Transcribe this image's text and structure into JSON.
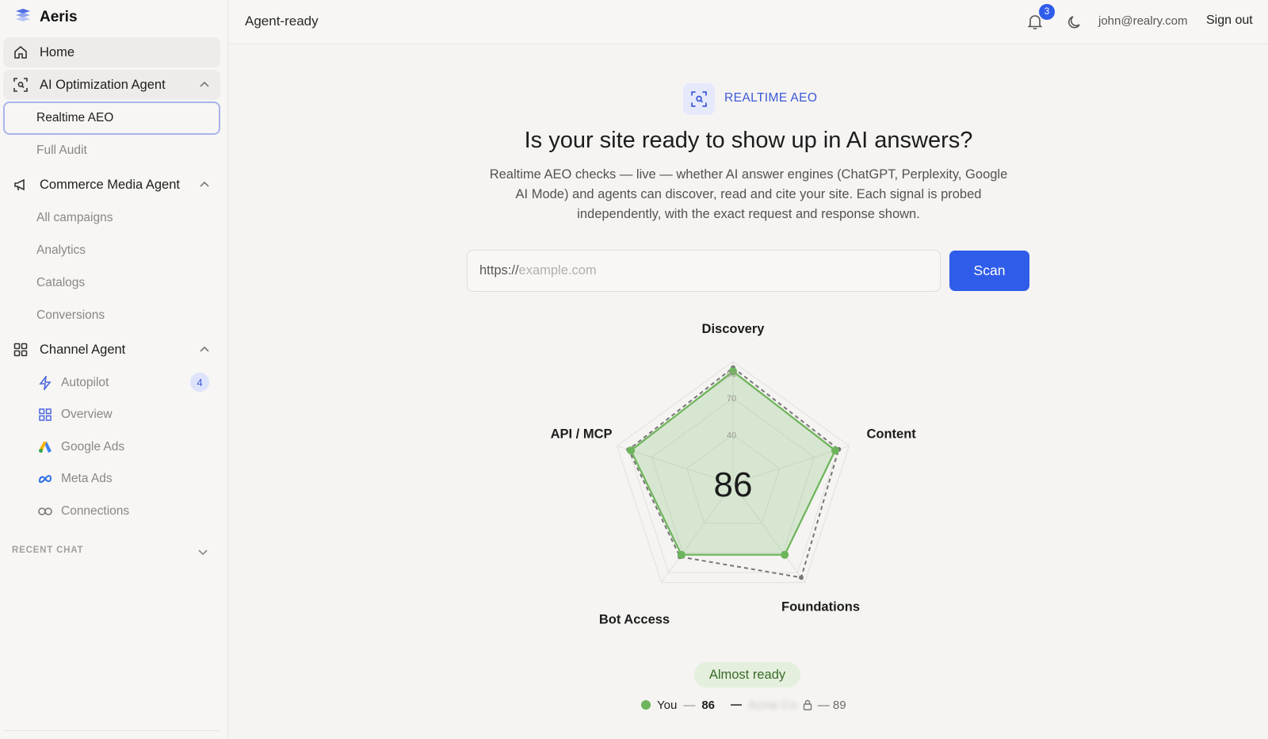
{
  "app": {
    "name": "Aeris"
  },
  "sidebar": {
    "home": "Home",
    "ai_agent": {
      "label": "AI Optimization Agent",
      "items": [
        "Realtime AEO",
        "Full Audit"
      ]
    },
    "commerce_agent": {
      "label": "Commerce Media Agent",
      "items": [
        "All campaigns",
        "Analytics",
        "Catalogs",
        "Conversions"
      ]
    },
    "channel_agent": {
      "label": "Channel Agent",
      "items": [
        {
          "label": "Autopilot",
          "icon": "lightning-icon",
          "count": "4"
        },
        {
          "label": "Overview",
          "icon": "grid-icon"
        },
        {
          "label": "Google Ads",
          "icon": "google-ads-icon"
        },
        {
          "label": "Meta Ads",
          "icon": "meta-icon"
        },
        {
          "label": "Connections",
          "icon": "link-icon"
        }
      ]
    },
    "recent_chat": "RECENT CHAT"
  },
  "header": {
    "breadcrumb": "Agent-ready",
    "notifications": "3",
    "email": "john@realry.com",
    "signout": "Sign out"
  },
  "main": {
    "tag": "REALTIME AEO",
    "headline": "Is your site ready to show up in AI answers?",
    "description": "Realtime AEO checks — live — whether AI answer engines (ChatGPT, Perplexity, Google AI Mode) and agents can discover, read and cite your site. Each signal is probed independently, with the exact request and response shown.",
    "url_prefix": "https://",
    "url_placeholder": "example.com",
    "scan_label": "Scan",
    "status": "Almost ready",
    "legend": {
      "you_label": "You",
      "you_score": "86",
      "competitor_name": "Acme Co",
      "competitor_score": "89"
    }
  },
  "chart_data": {
    "type": "radar",
    "axes": [
      "Discovery",
      "Content",
      "Foundations",
      "Bot Access",
      "API / MCP"
    ],
    "ticks": [
      40,
      70,
      90
    ],
    "max": 100,
    "center_value": "86",
    "series": [
      {
        "name": "You",
        "values": [
          92,
          88,
          72,
          72,
          88
        ],
        "color": "#6db45a",
        "style": "solid"
      },
      {
        "name": "Acme Co",
        "values": [
          95,
          91,
          95,
          74,
          90
        ],
        "color": "#777777",
        "style": "dashed"
      }
    ]
  },
  "colors": {
    "accent": "#2f5ce9",
    "you": "#6db45a",
    "ready_bg": "#e4f0dd"
  }
}
